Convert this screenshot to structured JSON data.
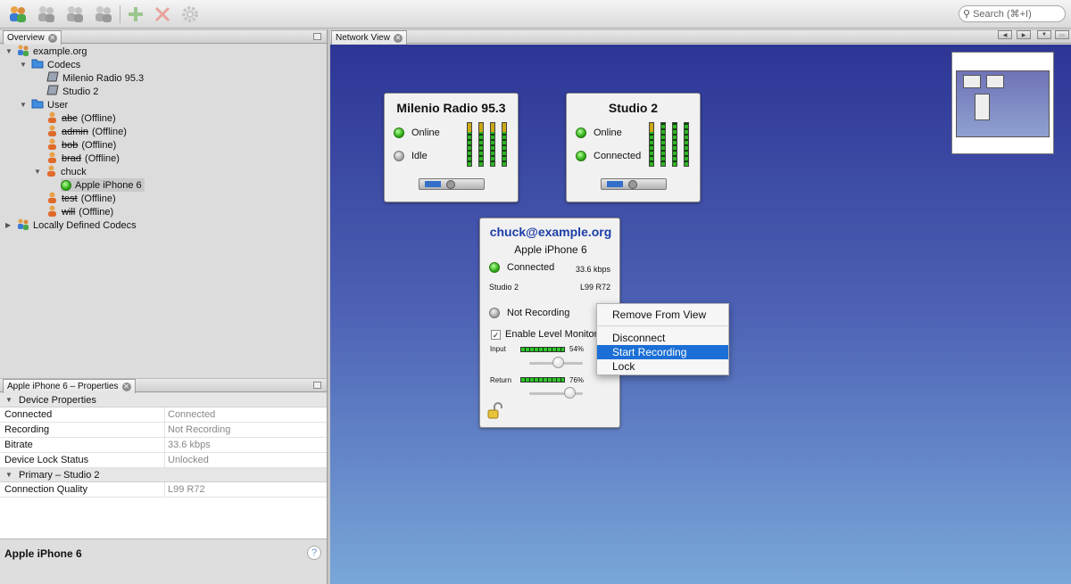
{
  "toolbar": {
    "search_placeholder": "Search (⌘+I)"
  },
  "overview": {
    "tab_label": "Overview",
    "tree": {
      "root": "example.org",
      "codecs_label": "Codecs",
      "codecs": [
        "Milenio Radio 95.3",
        "Studio 2"
      ],
      "user_label": "User",
      "users": [
        {
          "name": "abc",
          "status": "(Offline)"
        },
        {
          "name": "admin",
          "status": "(Offline)"
        },
        {
          "name": "bob",
          "status": "(Offline)"
        },
        {
          "name": "brad",
          "status": "(Offline)"
        }
      ],
      "chuck": "chuck",
      "chuck_device": "Apple iPhone 6",
      "users_after": [
        {
          "name": "test",
          "status": "(Offline)"
        },
        {
          "name": "will",
          "status": "(Offline)"
        }
      ],
      "local": "Locally Defined Codecs"
    }
  },
  "properties": {
    "tab_label": "Apple iPhone 6 – Properties",
    "group1": "Device Properties",
    "rows1": [
      {
        "k": "Connected",
        "v": "Connected"
      },
      {
        "k": "Recording",
        "v": "Not Recording"
      },
      {
        "k": "Bitrate",
        "v": "33.6 kbps"
      },
      {
        "k": "Device Lock Status",
        "v": "Unlocked"
      }
    ],
    "group2": "Primary – Studio 2",
    "rows2": [
      {
        "k": "Connection Quality",
        "v": "L99 R72"
      }
    ],
    "footer_title": "Apple iPhone 6",
    "help": "?"
  },
  "network": {
    "tab_label": "Network View",
    "card1": {
      "title": "Milenio Radio 95.3",
      "status1": "Online",
      "status2": "Idle"
    },
    "card2": {
      "title": "Studio 2",
      "status1": "Online",
      "status2": "Connected"
    },
    "card3": {
      "user": "chuck@example.org",
      "device": "Apple iPhone 6",
      "connected": "Connected",
      "bitrate": "33.6 kbps",
      "link": "Studio 2",
      "quality": "L99 R72",
      "recording": "Not Recording",
      "monitor": "Enable Level Monitori",
      "input_label": "Input",
      "input_pct": "54%",
      "input_level": 0.54,
      "return_label": "Return",
      "return_pct": "76%",
      "return_level": 0.76
    }
  },
  "context_menu": {
    "items": [
      "Remove From View",
      "Disconnect",
      "Start Recording",
      "Lock"
    ],
    "selected": "Start Recording"
  },
  "colors": {
    "accent": "#1b6fd6",
    "link_blue": "#1d3fa8"
  }
}
